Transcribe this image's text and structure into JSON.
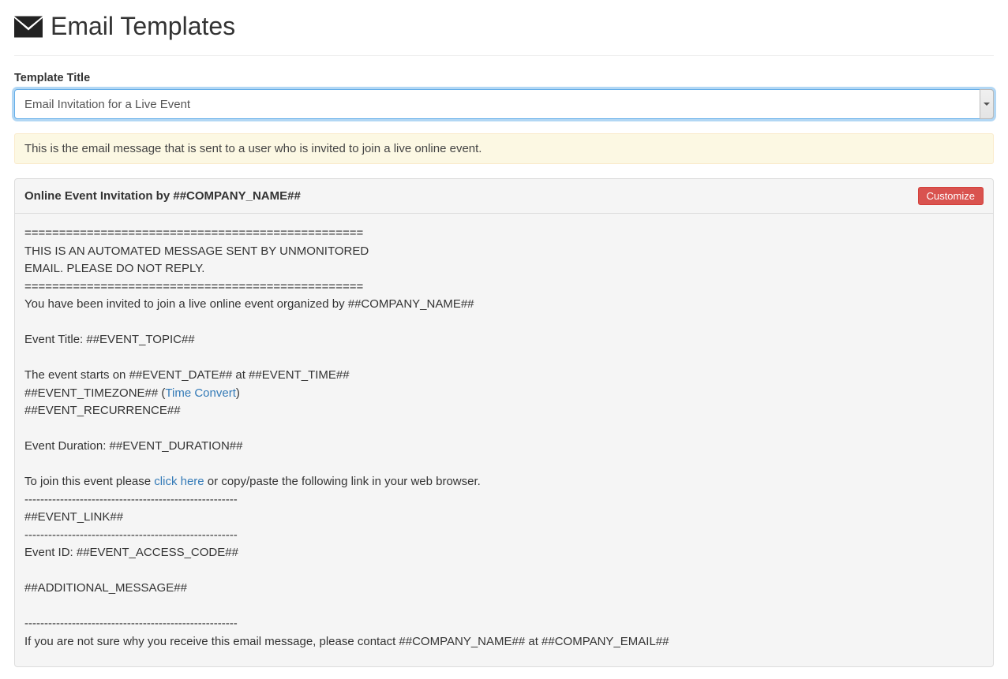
{
  "header": {
    "title": "Email Templates"
  },
  "form": {
    "label": "Template Title",
    "selected": "Email Invitation for a Live Event"
  },
  "description": "This is the email message that is sent to a user who is invited to join a live online event.",
  "panel": {
    "title": "Online Event Invitation by ##COMPANY_NAME##",
    "customize_label": "Customize"
  },
  "body": {
    "l0": "=================================================",
    "l1": "THIS IS AN AUTOMATED MESSAGE SENT BY UNMONITORED",
    "l2": "EMAIL. PLEASE DO NOT REPLY.",
    "l3": "=================================================",
    "l4": "You have been invited to join a live online event organized by ##COMPANY_NAME##",
    "l5": "",
    "l6": "Event Title: ##EVENT_TOPIC##",
    "l7": "",
    "l8": "The event starts on ##EVENT_DATE## at ##EVENT_TIME##",
    "l9a": "##EVENT_TIMEZONE## (",
    "l9link": "Time Convert",
    "l9b": ")",
    "l10": "##EVENT_RECURRENCE##",
    "l11": "",
    "l12": "Event Duration: ##EVENT_DURATION##",
    "l13": "",
    "l14a": "To join this event please ",
    "l14link": "click here",
    "l14b": " or copy/paste the following link in your web browser.",
    "l15": "------------------------------------------------------",
    "l16": "##EVENT_LINK##",
    "l17": "------------------------------------------------------",
    "l18": "Event ID: ##EVENT_ACCESS_CODE##",
    "l19": "",
    "l20": "##ADDITIONAL_MESSAGE##",
    "l21": "",
    "l22": "------------------------------------------------------",
    "l23": "If you are not sure why you receive this email message, please contact ##COMPANY_NAME## at ##COMPANY_EMAIL##"
  }
}
